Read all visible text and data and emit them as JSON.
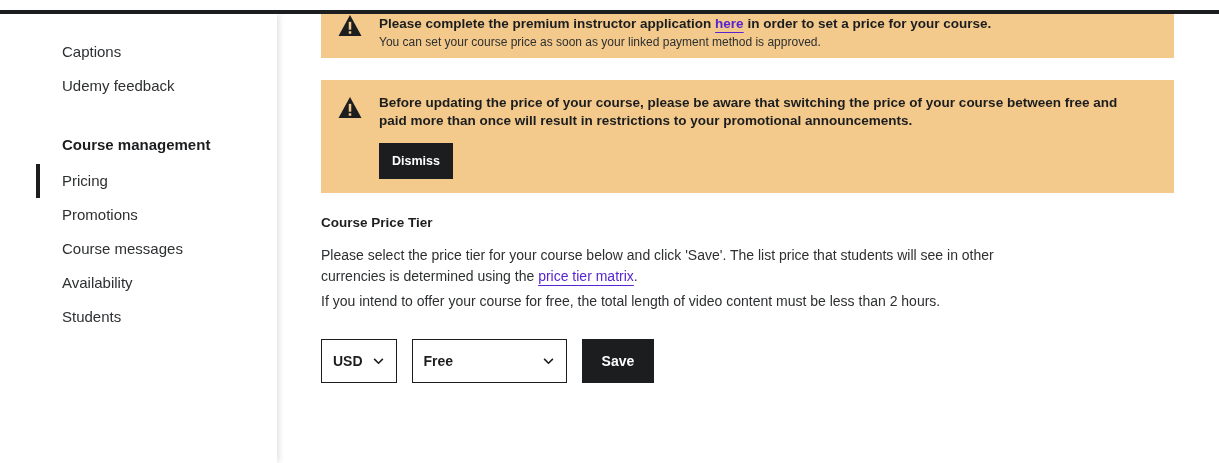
{
  "sidebar": {
    "groups": [
      {
        "items": [
          {
            "label": "Captions",
            "selected": false
          },
          {
            "label": "Udemy feedback",
            "selected": false
          }
        ]
      },
      {
        "title": "Course management",
        "items": [
          {
            "label": "Pricing",
            "selected": true
          },
          {
            "label": "Promotions",
            "selected": false
          },
          {
            "label": "Course messages",
            "selected": false
          },
          {
            "label": "Availability",
            "selected": false
          },
          {
            "label": "Students",
            "selected": false
          }
        ]
      }
    ]
  },
  "alerts": [
    {
      "text_before": "Please complete the premium instructor application",
      "link": "here",
      "text_after": "in order to set a price for your course.",
      "note": "You can set your course price as soon as your linked payment method is approved."
    },
    {
      "text": "Before updating the price of your course, please be aware that switching the price of your course between free and paid more than once will result in restrictions to your promotional announcements.",
      "button": "Dismiss"
    }
  ],
  "price_tier": {
    "title": "Course Price Tier",
    "description_before": "Please select the price tier for your course below and click 'Save'. The list price that students will see in other currencies is determined using the",
    "link": "price tier matrix",
    "description_after": ".",
    "note": "If you intend to offer your course for free, the total length of video content must be less than 2 hours.",
    "currency": "USD",
    "tier": "Free",
    "save": "Save"
  }
}
